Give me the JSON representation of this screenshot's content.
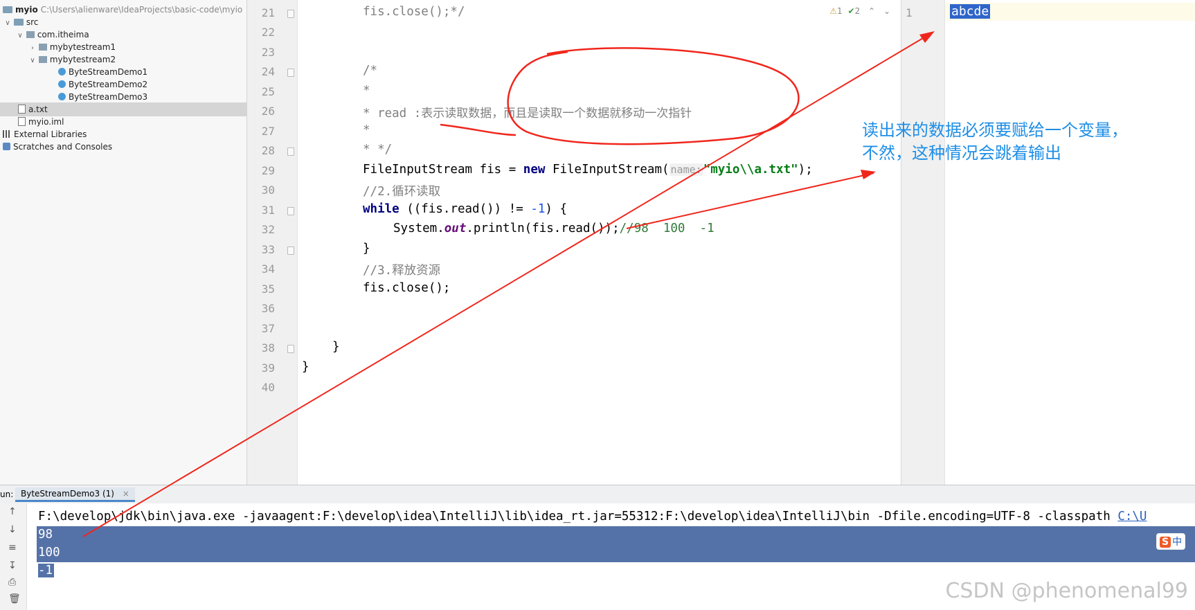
{
  "project_tree": {
    "root_name": "myio",
    "root_path": "C:\\Users\\alienware\\IdeaProjects\\basic-code\\myio",
    "items": [
      {
        "label": "src"
      },
      {
        "label": "com.itheima"
      },
      {
        "label": "mybytestream1"
      },
      {
        "label": "mybytestream2"
      },
      {
        "label": "ByteStreamDemo1"
      },
      {
        "label": "ByteStreamDemo2"
      },
      {
        "label": "ByteStreamDemo3"
      },
      {
        "label": "a.txt"
      },
      {
        "label": "myio.iml"
      },
      {
        "label": "External Libraries"
      },
      {
        "label": "Scratches and Consoles"
      }
    ]
  },
  "editor": {
    "inspection": {
      "warnings": "1",
      "typos": "2"
    },
    "line_numbers": [
      "21",
      "22",
      "23",
      "24",
      "25",
      "26",
      "27",
      "28",
      "29",
      "30",
      "31",
      "32",
      "33",
      "34",
      "35",
      "36",
      "37",
      "38",
      "39",
      "40"
    ],
    "code": {
      "l21": "fis.close();*/",
      "l24": "/*",
      "l25": "*",
      "l26_a": "* read :",
      "l26_b": "表示读取数据，而且是读取一个数据就移动一次指针",
      "l27": "*",
      "l28": "* */",
      "l29_a": "FileInputStream fis = ",
      "l29_kw": "new",
      "l29_b": " FileInputStream(",
      "l29_hint": "name:",
      "l29_str": "\"myio\\\\a.txt\"",
      "l29_c": ");",
      "l30": "//2.循环读取",
      "l31_kw": "while",
      "l31_a": " ((fis.read()) != ",
      "l31_num": "-1",
      "l31_b": ") {",
      "l32_a": "System.",
      "l32_fld": "out",
      "l32_b": ".println(fis.read());",
      "l32_cm": "//98  100  -1",
      "l33": "}",
      "l34": "//3.释放资源",
      "l35": "fis.close();",
      "l38": "}",
      "l39": "}"
    }
  },
  "file_pane": {
    "line_number": "1",
    "content": "abcde"
  },
  "run": {
    "label": "un:",
    "tab_label": "ByteStreamDemo3 (1)",
    "command_a": "F:\\develop\\jdk\\bin\\java.exe -javaagent:F:\\develop\\idea\\IntelliJ\\lib\\idea_rt.jar=55312:F:\\develop\\idea\\IntelliJ\\bin -Dfile.encoding=UTF-8 -classpath ",
    "command_link": "C:\\U",
    "output": [
      "98",
      "100",
      "-1"
    ]
  },
  "annotation": {
    "note": "读出来的数据必须要赋给一个变量，\n不然，这种情况会跳着输出",
    "color": "#1e8ee6",
    "arrow_color": "#f0261c"
  },
  "watermark": "CSDN @phenomenal99",
  "ime": {
    "brand": "S",
    "label": "中"
  }
}
